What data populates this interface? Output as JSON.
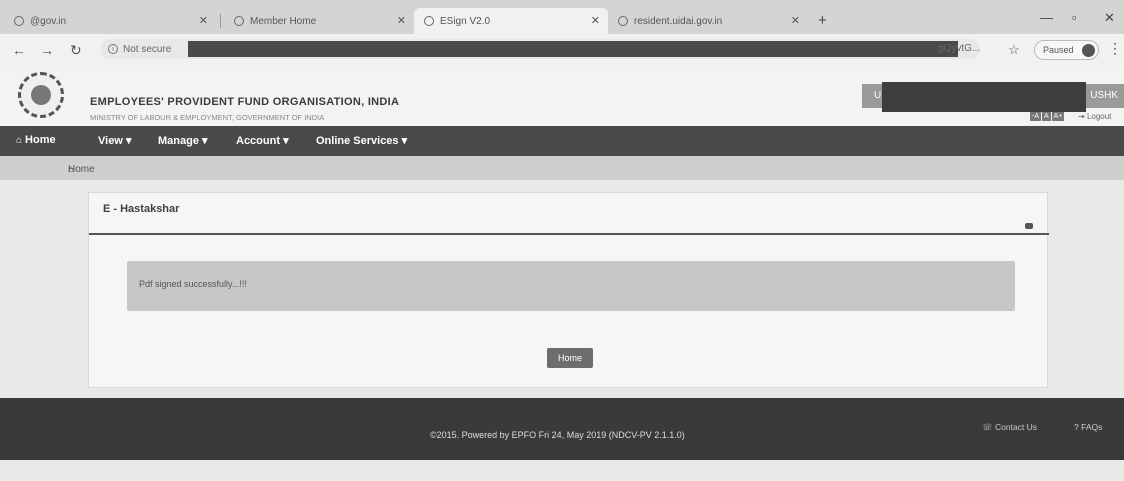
{
  "tabs": [
    {
      "title": "@gov.in",
      "active": false
    },
    {
      "title": "Member Home",
      "active": false
    },
    {
      "title": "ESign V2.0",
      "active": true
    },
    {
      "title": "resident.uidai.gov.in",
      "active": false
    }
  ],
  "address_bar": {
    "security_label": "Not secure",
    "url_tail": "gQyvtG...",
    "profile_label": "Paused"
  },
  "header": {
    "org_name": "EMPLOYEES' PROVIDENT FUND ORGANISATION, INDIA",
    "org_subtitle": "MINISTRY OF LABOUR & EMPLOYMENT, GOVERNMENT OF INDIA",
    "user_prefix": "U",
    "user_suffix": "USHK",
    "font_buttons": [
      "-A",
      "A",
      "A+"
    ],
    "logout_label": "Logout"
  },
  "navbar": {
    "home": "Home",
    "view": "View",
    "manage": "Manage",
    "account": "Account",
    "online_services": "Online Services"
  },
  "breadcrumb": "Home",
  "panel": {
    "title": "E - Hastakshar",
    "message": "Pdf signed successfully...!!!",
    "home_button": "Home"
  },
  "footer": {
    "copyright": "©2015. Powered by EPFO Fri 24, May 2019 (NDCV-PV 2.1.1.0)",
    "contact": "Contact Us",
    "faqs": "FAQs"
  }
}
